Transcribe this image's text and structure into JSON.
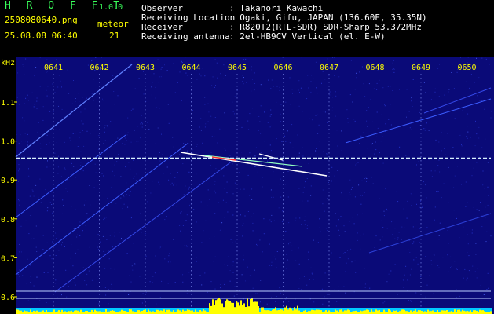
{
  "header": {
    "app_name": "H R O F F T",
    "version": "1.0.0",
    "filename": "2508080640.png",
    "datetime": "25.08.08 06:40",
    "meteor_label": "meteor",
    "meteor_count": "21",
    "observer_label": "Observer",
    "observer_value": ": Takanori Kawachi",
    "location_label": "Receiving Location",
    "location_value": ": Ogaki, Gifu, JAPAN (136.60E, 35.35N)",
    "receiver_label": "Receiver",
    "receiver_value": ": R820T2(RTL-SDR) SDR-Sharp 53.372MHz",
    "antenna_label": "Receiving antenna",
    "antenna_value": ": 2el-HB9CV Vertical (el. E-W)"
  },
  "plot": {
    "unit_label": "kHz",
    "time_ticks": [
      "0641",
      "0642",
      "0643",
      "0644",
      "0645",
      "0646",
      "0647",
      "0648",
      "0649",
      "0650"
    ],
    "freq_ticks": [
      "1.1",
      "1.0",
      "0.9",
      "0.8",
      "0.7",
      "0.6"
    ],
    "background_color": "#0a0a78",
    "noise_color": "#2a3ad8",
    "carrier_color": "#d8f0ff",
    "meteor_color": "#ffffff",
    "highlight_color": "#ff3030",
    "spectrum_color": "#ffff00",
    "baseline_color": "#00c8ff"
  }
}
